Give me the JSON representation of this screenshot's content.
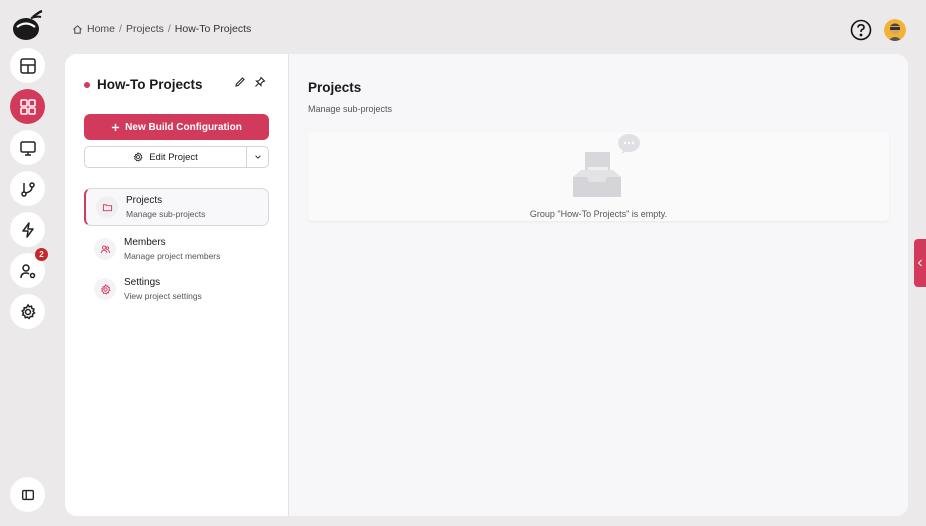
{
  "breadcrumb": {
    "home": "Home",
    "separator": "/",
    "projects": "Projects",
    "current": "How-To Projects"
  },
  "rail": {
    "notifications_badge": "2"
  },
  "sidebar": {
    "project_title": "How-To Projects",
    "new_build_label": "New Build Configuration",
    "edit_project_label": "Edit Project",
    "items": [
      {
        "label": "Projects",
        "sublabel": "Manage sub-projects"
      },
      {
        "label": "Members",
        "sublabel": "Manage project members"
      },
      {
        "label": "Settings",
        "sublabel": "View project settings"
      }
    ]
  },
  "main": {
    "title": "Projects",
    "subtitle": "Manage sub-projects",
    "empty_message": "Group \"How-To Projects\" is empty."
  },
  "colors": {
    "accent": "#d23a5c",
    "badge": "#c62828",
    "background": "#ebe9ea"
  }
}
